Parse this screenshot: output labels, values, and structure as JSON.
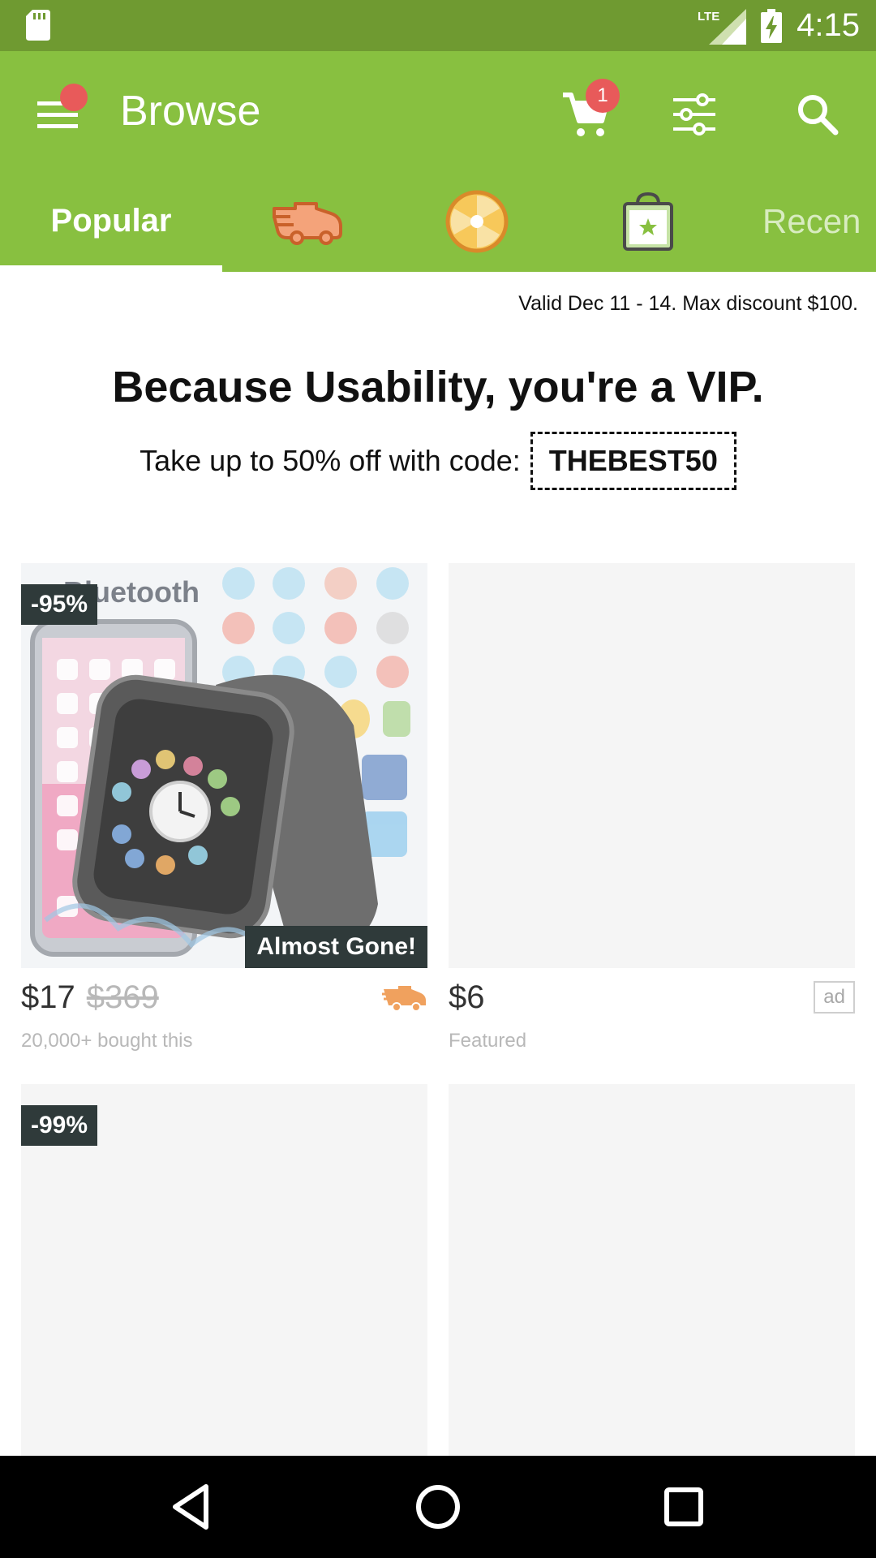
{
  "status_bar": {
    "time": "4:15",
    "network": "LTE",
    "icons": [
      "sd-card-icon",
      "signal-icon",
      "battery-charging-icon"
    ]
  },
  "app_bar": {
    "title": "Browse",
    "cart_count": "1",
    "icons": [
      "menu-icon",
      "cart-icon",
      "filter-icon",
      "search-icon"
    ]
  },
  "tabs": [
    {
      "label": "Popular",
      "selected": true
    },
    {
      "icon": "delivery-truck-icon"
    },
    {
      "icon": "deal-wheel-icon"
    },
    {
      "icon": "shopping-bag-star-icon"
    },
    {
      "label": "Recen"
    }
  ],
  "promo": {
    "valid": "Valid Dec 11 - 14. Max discount $100.",
    "title": "Because Usability, you're a VIP.",
    "text": "Take up to 50% off with code:",
    "code": "THEBEST50"
  },
  "products": [
    {
      "discount": "-95%",
      "tag": "Almost Gone!",
      "price": "$17",
      "old_price": "$369",
      "meta": "20,000+ bought this",
      "image_text": "Bluetooth"
    },
    {
      "price": "$6",
      "ad": "ad",
      "meta": "Featured"
    },
    {
      "discount": "-99%"
    },
    {}
  ],
  "colors": {
    "status_bar": "#6f9a31",
    "app_bar": "#88c040",
    "badge": "#2f3a3a",
    "notification": "#e85a5a"
  }
}
